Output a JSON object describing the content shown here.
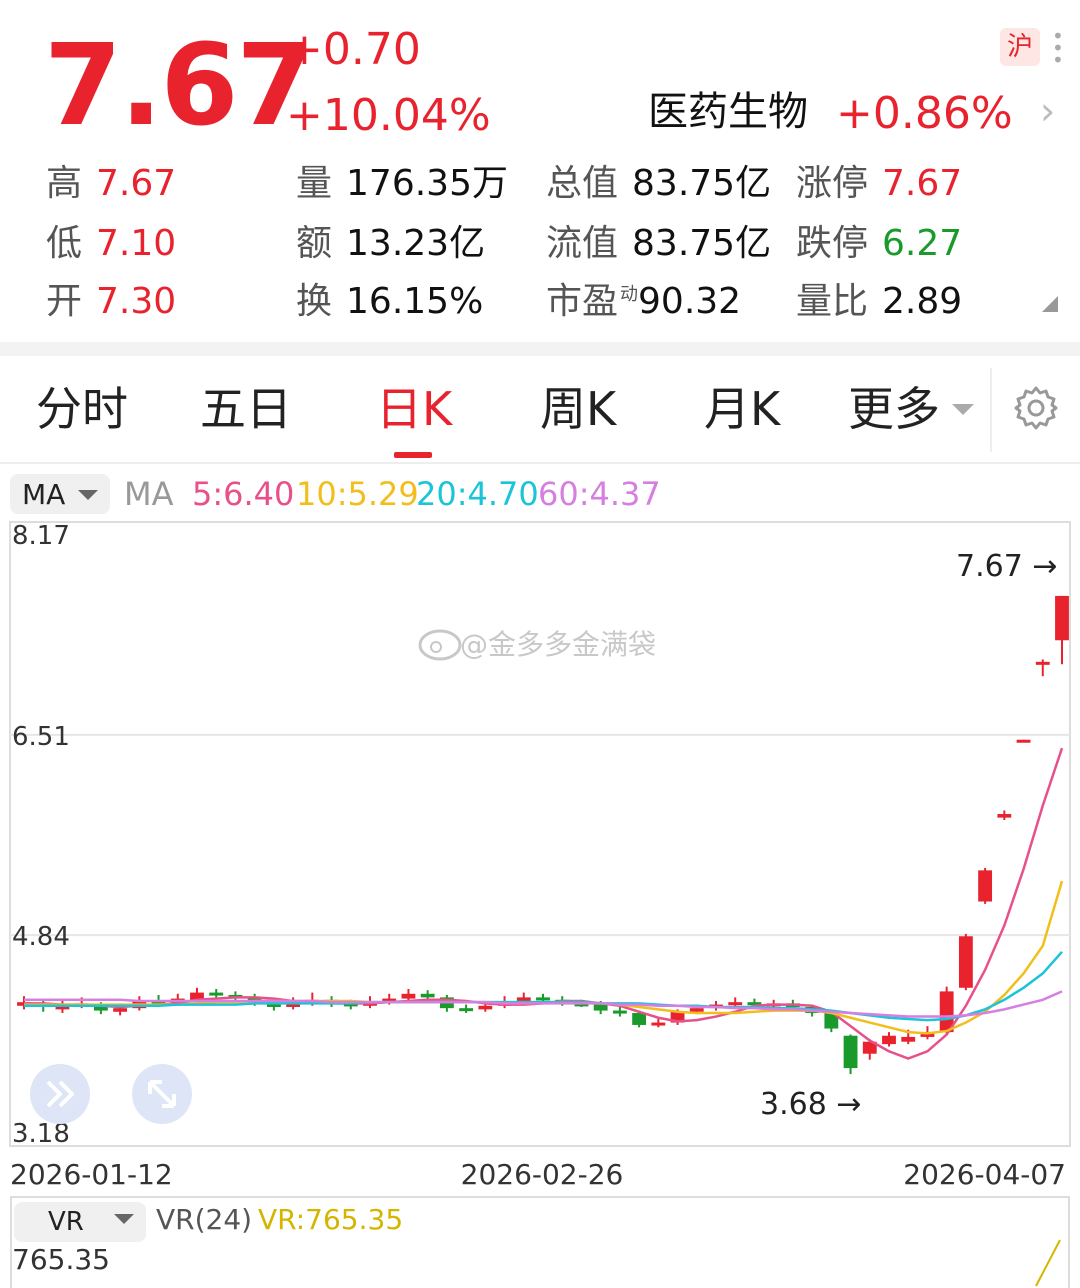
{
  "quote": {
    "price": "7.67",
    "change": "+0.70",
    "change_pct": "+10.04%",
    "market_badge": "沪",
    "sector_name": "医药生物",
    "sector_change": "+0.86%"
  },
  "stats": [
    {
      "k": "高",
      "v": "7.67",
      "color": "red"
    },
    {
      "k": "低",
      "v": "7.10",
      "color": "red"
    },
    {
      "k": "开",
      "v": "7.30",
      "color": "red"
    },
    {
      "k": "量",
      "v": "176.35万",
      "color": ""
    },
    {
      "k": "额",
      "v": "13.23亿",
      "color": ""
    },
    {
      "k": "换",
      "v": "16.15%",
      "color": ""
    },
    {
      "k": "总值",
      "v": "83.75亿",
      "color": ""
    },
    {
      "k": "流值",
      "v": "83.75亿",
      "color": ""
    },
    {
      "k": "市盈",
      "sup": "动",
      "v": "90.32",
      "color": ""
    },
    {
      "k": "涨停",
      "v": "7.67",
      "color": "red"
    },
    {
      "k": "跌停",
      "v": "6.27",
      "color": "green"
    },
    {
      "k": "量比",
      "v": "2.89",
      "color": ""
    }
  ],
  "tabs": [
    "分时",
    "五日",
    "日K",
    "周K",
    "月K",
    "更多"
  ],
  "active_tab": "日K",
  "ma": {
    "select_label": "MA",
    "label": "MA",
    "values": [
      {
        "text": "5:6.40",
        "color": "#e8508a"
      },
      {
        "text": "10:5.29",
        "color": "#f2be1c"
      },
      {
        "text": "20:4.70",
        "color": "#1cc3d9"
      },
      {
        "text": "60:4.37",
        "color": "#d77fe0"
      }
    ]
  },
  "chart_data": {
    "type": "candlestick",
    "y_ticks": [
      "8.17",
      "6.51",
      "4.84",
      "3.18"
    ],
    "ylim": [
      3.18,
      8.17
    ],
    "x_ticks": [
      "2026-01-12",
      "2026-02-26",
      "2026-04-07"
    ],
    "high_label": "7.67 →",
    "low_label": "3.68 →",
    "watermark": "@金多多金满袋",
    "candles": [
      {
        "o": 4.25,
        "c": 4.28,
        "h": 4.33,
        "l": 4.22
      },
      {
        "o": 4.27,
        "c": 4.24,
        "h": 4.31,
        "l": 4.2
      },
      {
        "o": 4.22,
        "c": 4.26,
        "h": 4.3,
        "l": 4.19
      },
      {
        "o": 4.26,
        "c": 4.27,
        "h": 4.32,
        "l": 4.23
      },
      {
        "o": 4.25,
        "c": 4.21,
        "h": 4.28,
        "l": 4.18
      },
      {
        "o": 4.2,
        "c": 4.23,
        "h": 4.27,
        "l": 4.17
      },
      {
        "o": 4.23,
        "c": 4.29,
        "h": 4.33,
        "l": 4.21
      },
      {
        "o": 4.29,
        "c": 4.27,
        "h": 4.34,
        "l": 4.25
      },
      {
        "o": 4.27,
        "c": 4.31,
        "h": 4.35,
        "l": 4.25
      },
      {
        "o": 4.3,
        "c": 4.36,
        "h": 4.4,
        "l": 4.28
      },
      {
        "o": 4.36,
        "c": 4.34,
        "h": 4.39,
        "l": 4.31
      },
      {
        "o": 4.34,
        "c": 4.32,
        "h": 4.37,
        "l": 4.29
      },
      {
        "o": 4.32,
        "c": 4.28,
        "h": 4.35,
        "l": 4.25
      },
      {
        "o": 4.28,
        "c": 4.24,
        "h": 4.31,
        "l": 4.21
      },
      {
        "o": 4.24,
        "c": 4.27,
        "h": 4.32,
        "l": 4.22
      },
      {
        "o": 4.27,
        "c": 4.3,
        "h": 4.36,
        "l": 4.25
      },
      {
        "o": 4.3,
        "c": 4.27,
        "h": 4.33,
        "l": 4.24
      },
      {
        "o": 4.27,
        "c": 4.25,
        "h": 4.3,
        "l": 4.22
      },
      {
        "o": 4.25,
        "c": 4.28,
        "h": 4.33,
        "l": 4.23
      },
      {
        "o": 4.28,
        "c": 4.31,
        "h": 4.35,
        "l": 4.26
      },
      {
        "o": 4.31,
        "c": 4.35,
        "h": 4.39,
        "l": 4.29
      },
      {
        "o": 4.35,
        "c": 4.32,
        "h": 4.38,
        "l": 4.3
      },
      {
        "o": 4.32,
        "c": 4.23,
        "h": 4.34,
        "l": 4.2
      },
      {
        "o": 4.23,
        "c": 4.22,
        "h": 4.26,
        "l": 4.19
      },
      {
        "o": 4.22,
        "c": 4.25,
        "h": 4.29,
        "l": 4.2
      },
      {
        "o": 4.25,
        "c": 4.28,
        "h": 4.33,
        "l": 4.23
      },
      {
        "o": 4.28,
        "c": 4.32,
        "h": 4.36,
        "l": 4.26
      },
      {
        "o": 4.32,
        "c": 4.3,
        "h": 4.35,
        "l": 4.27
      },
      {
        "o": 4.3,
        "c": 4.27,
        "h": 4.33,
        "l": 4.25
      },
      {
        "o": 4.27,
        "c": 4.26,
        "h": 4.3,
        "l": 4.24
      },
      {
        "o": 4.26,
        "c": 4.21,
        "h": 4.29,
        "l": 4.18
      },
      {
        "o": 4.21,
        "c": 4.19,
        "h": 4.24,
        "l": 4.16
      },
      {
        "o": 4.19,
        "c": 4.09,
        "h": 4.21,
        "l": 4.07
      },
      {
        "o": 4.09,
        "c": 4.11,
        "h": 4.14,
        "l": 4.07
      },
      {
        "o": 4.11,
        "c": 4.2,
        "h": 4.22,
        "l": 4.09
      },
      {
        "o": 4.2,
        "c": 4.23,
        "h": 4.26,
        "l": 4.18
      },
      {
        "o": 4.23,
        "c": 4.26,
        "h": 4.29,
        "l": 4.21
      },
      {
        "o": 4.26,
        "c": 4.28,
        "h": 4.32,
        "l": 4.24
      },
      {
        "o": 4.28,
        "c": 4.26,
        "h": 4.31,
        "l": 4.23
      },
      {
        "o": 4.26,
        "c": 4.27,
        "h": 4.3,
        "l": 4.23
      },
      {
        "o": 4.27,
        "c": 4.24,
        "h": 4.3,
        "l": 4.21
      },
      {
        "o": 4.24,
        "c": 4.19,
        "h": 4.26,
        "l": 4.16
      },
      {
        "o": 4.19,
        "c": 4.06,
        "h": 4.21,
        "l": 4.03
      },
      {
        "o": 4.0,
        "c": 3.73,
        "h": 4.01,
        "l": 3.68
      },
      {
        "o": 3.85,
        "c": 3.95,
        "h": 3.97,
        "l": 3.8
      },
      {
        "o": 3.93,
        "c": 4.0,
        "h": 4.03,
        "l": 3.91
      },
      {
        "o": 3.95,
        "c": 3.99,
        "h": 4.05,
        "l": 3.93
      },
      {
        "o": 3.99,
        "c": 4.03,
        "h": 4.08,
        "l": 3.97
      },
      {
        "o": 4.03,
        "c": 4.37,
        "h": 4.41,
        "l": 4.01
      },
      {
        "o": 4.4,
        "c": 4.83,
        "h": 4.85,
        "l": 4.38
      },
      {
        "o": 5.12,
        "c": 5.38,
        "h": 5.4,
        "l": 5.1
      },
      {
        "o": 5.82,
        "c": 5.85,
        "h": 5.88,
        "l": 5.8
      },
      {
        "o": 6.45,
        "c": 6.47,
        "h": 6.47,
        "l": 6.45
      },
      {
        "o": 7.1,
        "c": 7.12,
        "h": 7.14,
        "l": 7.0
      },
      {
        "o": 7.3,
        "c": 7.67,
        "h": 7.67,
        "l": 7.1
      }
    ],
    "ma_lines": [
      {
        "name": "5",
        "color": "#e8508a",
        "values": [
          4.27,
          4.27,
          4.26,
          4.26,
          4.25,
          4.24,
          4.25,
          4.26,
          4.27,
          4.3,
          4.31,
          4.32,
          4.32,
          4.31,
          4.29,
          4.28,
          4.27,
          4.27,
          4.27,
          4.28,
          4.29,
          4.3,
          4.3,
          4.29,
          4.27,
          4.26,
          4.26,
          4.27,
          4.29,
          4.29,
          4.27,
          4.25,
          4.2,
          4.15,
          4.12,
          4.13,
          4.16,
          4.2,
          4.25,
          4.26,
          4.26,
          4.25,
          4.2,
          4.08,
          3.96,
          3.87,
          3.81,
          3.87,
          4.01,
          4.25,
          4.55,
          4.92,
          5.39,
          5.92,
          6.4
        ]
      },
      {
        "name": "10",
        "color": "#f2be1c",
        "values": [
          4.26,
          4.26,
          4.26,
          4.26,
          4.26,
          4.26,
          4.26,
          4.26,
          4.26,
          4.27,
          4.28,
          4.28,
          4.29,
          4.29,
          4.29,
          4.29,
          4.29,
          4.29,
          4.28,
          4.28,
          4.28,
          4.28,
          4.28,
          4.28,
          4.28,
          4.28,
          4.28,
          4.28,
          4.28,
          4.28,
          4.27,
          4.26,
          4.24,
          4.22,
          4.2,
          4.19,
          4.19,
          4.19,
          4.2,
          4.21,
          4.21,
          4.21,
          4.19,
          4.15,
          4.11,
          4.07,
          4.03,
          4.02,
          4.04,
          4.11,
          4.2,
          4.34,
          4.52,
          4.75,
          5.29
        ]
      },
      {
        "name": "20",
        "color": "#1cc3d9",
        "values": [
          4.25,
          4.25,
          4.25,
          4.25,
          4.25,
          4.25,
          4.25,
          4.25,
          4.26,
          4.26,
          4.26,
          4.26,
          4.27,
          4.27,
          4.27,
          4.27,
          4.27,
          4.27,
          4.28,
          4.28,
          4.28,
          4.28,
          4.28,
          4.28,
          4.28,
          4.28,
          4.28,
          4.28,
          4.28,
          4.28,
          4.27,
          4.27,
          4.27,
          4.26,
          4.25,
          4.25,
          4.24,
          4.24,
          4.24,
          4.23,
          4.23,
          4.22,
          4.21,
          4.19,
          4.17,
          4.15,
          4.14,
          4.13,
          4.14,
          4.17,
          4.22,
          4.3,
          4.4,
          4.52,
          4.7
        ]
      },
      {
        "name": "60",
        "color": "#d77fe0",
        "values": [
          4.3,
          4.3,
          4.3,
          4.3,
          4.3,
          4.3,
          4.29,
          4.29,
          4.29,
          4.29,
          4.29,
          4.29,
          4.29,
          4.29,
          4.29,
          4.29,
          4.28,
          4.28,
          4.28,
          4.28,
          4.28,
          4.28,
          4.28,
          4.28,
          4.28,
          4.27,
          4.27,
          4.27,
          4.27,
          4.27,
          4.27,
          4.26,
          4.26,
          4.25,
          4.25,
          4.24,
          4.24,
          4.23,
          4.23,
          4.22,
          4.22,
          4.21,
          4.2,
          4.19,
          4.18,
          4.17,
          4.16,
          4.16,
          4.16,
          4.17,
          4.19,
          4.22,
          4.26,
          4.3,
          4.37
        ]
      }
    ]
  },
  "vr": {
    "select_label": "VR",
    "label": "VR(24)",
    "value": "VR:765.35",
    "axis_top": "765.35"
  }
}
